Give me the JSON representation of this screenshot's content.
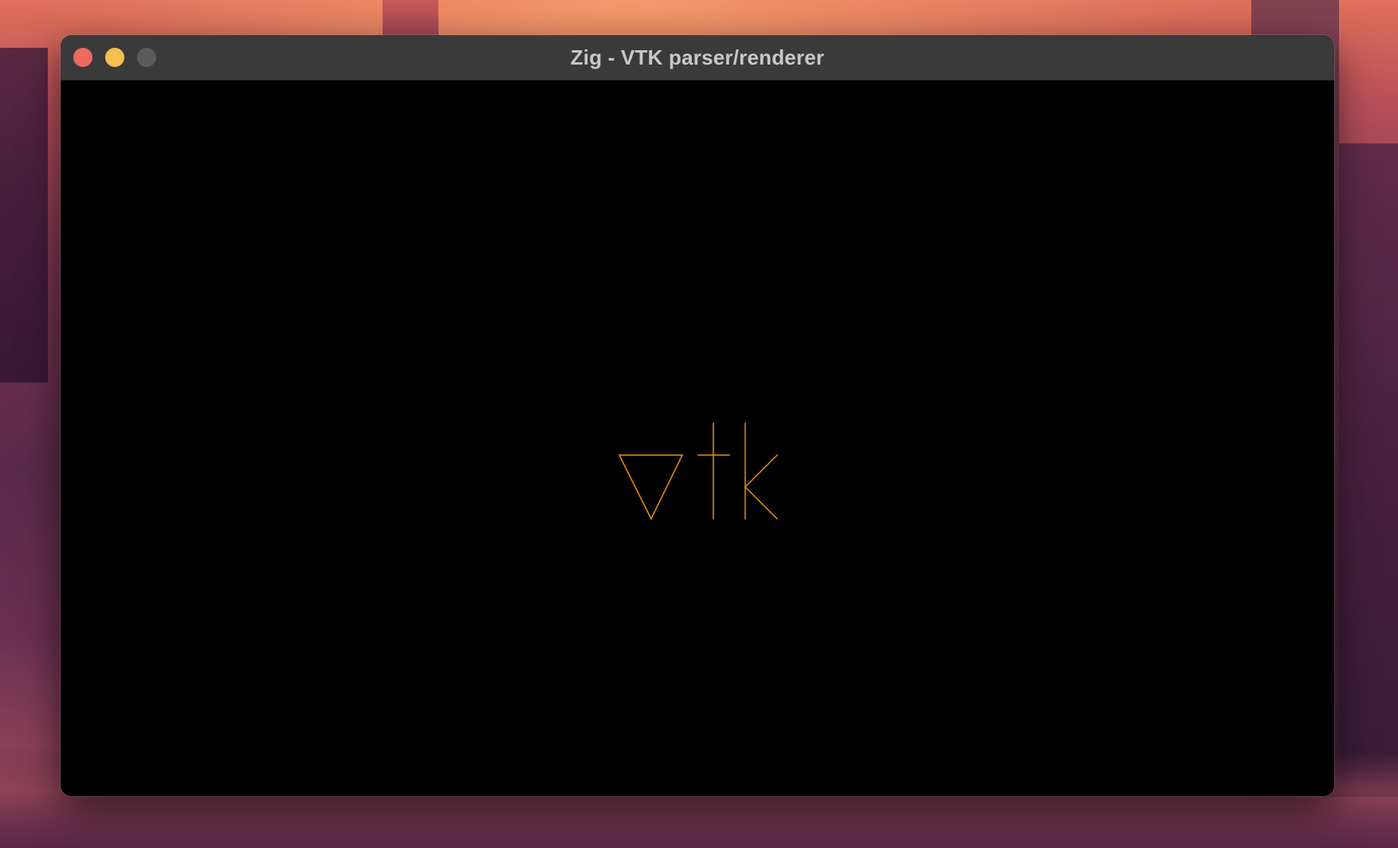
{
  "window": {
    "title": "Zig - VTK parser/renderer",
    "controls": {
      "close": {
        "icon": "close-icon",
        "color": "#ed6a5e"
      },
      "minimize": {
        "icon": "minimize-icon",
        "color": "#f4bf4f"
      },
      "zoom": {
        "icon": "zoom-icon",
        "color": "#5a5a5a"
      }
    }
  },
  "viewport": {
    "background_color": "#000000",
    "render": {
      "description_name": "vtk-logo-wireframe",
      "stroke_color": "#e8910e"
    }
  }
}
